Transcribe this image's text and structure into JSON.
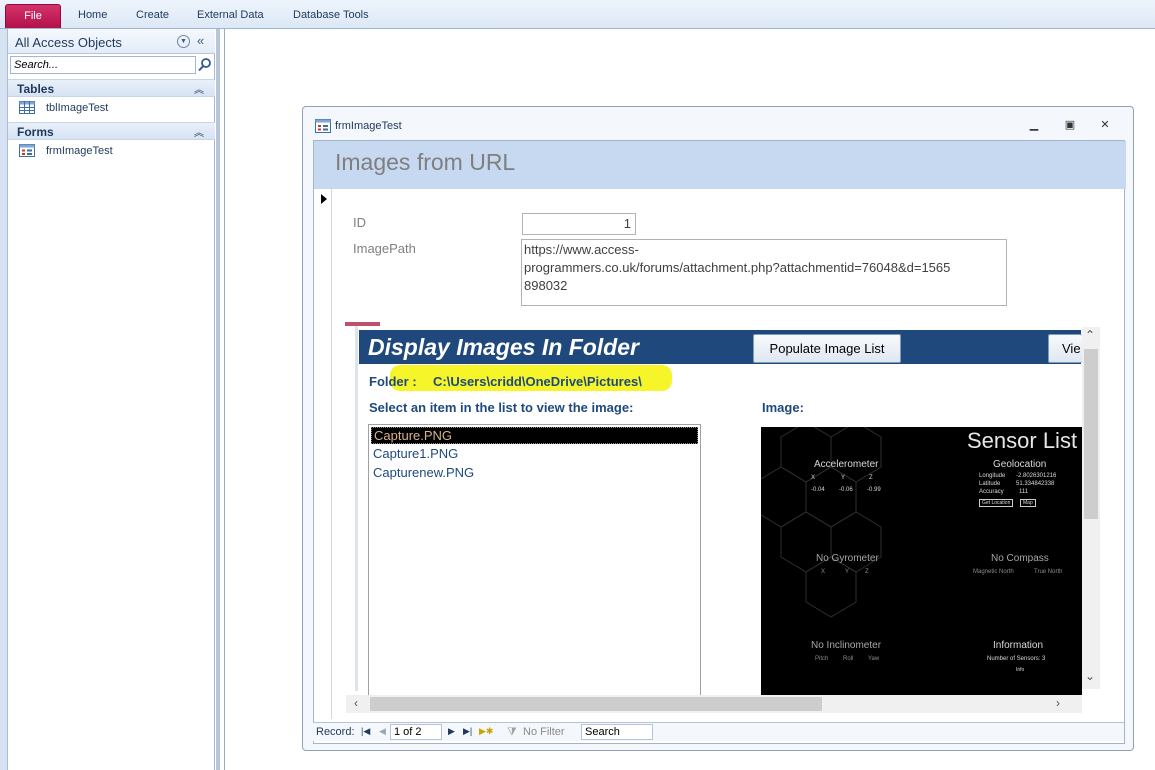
{
  "ribbon": {
    "tabs": [
      "File",
      "Home",
      "Create",
      "External Data",
      "Database Tools"
    ]
  },
  "nav": {
    "title": "All Access Objects",
    "search_placeholder": "Search...",
    "groups": [
      {
        "label": "Tables",
        "items": [
          {
            "label": "tblImageTest",
            "icon": "table-icon"
          }
        ]
      },
      {
        "label": "Forms",
        "items": [
          {
            "label": "frmImageTest",
            "icon": "form-icon"
          }
        ]
      }
    ]
  },
  "form_window": {
    "title": "frmImageTest",
    "header_title": "Images from URL",
    "fields": {
      "id_label": "ID",
      "id_value": "1",
      "path_label": "ImagePath",
      "path_value": "https://www.access-programmers.co.uk/forums/attachment.php?attachmentid=76048&d=1565898032",
      "path_lines": [
        "https://www.access-",
        "programmers.co.uk/forums/attachment.php?attachmentid=76048&d=1565",
        "898032"
      ]
    },
    "subform": {
      "title": "Display Images In Folder",
      "populate_button": "Populate Image List",
      "view_button": "Vie",
      "folder_label": "Folder :",
      "folder_path": "C:\\Users\\cridd\\OneDrive\\Pictures\\",
      "list_prompt": "Select an item in the list to view the image:",
      "image_label": "Image:",
      "files": [
        "Capture.PNG",
        "Capture1.PNG",
        "Capturenew.PNG"
      ],
      "selected_index": 0,
      "image": {
        "heading": "Sensor List",
        "accelerometer": "Accelerometer",
        "axes": [
          "X",
          "Y",
          "Z"
        ],
        "accel_values": [
          "-0.04",
          "-0.06",
          "-0.99"
        ],
        "geolocation": "Geolocation",
        "geo_rows": [
          {
            "k": "Longitude",
            "v": "-2.8026301216"
          },
          {
            "k": "Latitude",
            "v": "51.334842338"
          },
          {
            "k": "Accuracy",
            "v": "111"
          }
        ],
        "get_location": "Get Location",
        "map": "Map",
        "no_gyrometer": "No Gyrometer",
        "no_compass": "No Compass",
        "compass_sub": [
          "Magnetic North",
          "True North"
        ],
        "no_inclinometer": "No Inclinometer",
        "incl_sub": [
          "Pitch",
          "Roll",
          "Yaw"
        ],
        "information": "Information",
        "num_sensors": "Number of Sensors: 3",
        "info": "Info"
      }
    },
    "record_nav": {
      "label": "Record:",
      "position": "1 of 2",
      "filter": "No Filter",
      "search": "Search"
    }
  },
  "colors": {
    "file_tab": "#c2185b",
    "form_header": "#c6d9f1",
    "subform_header": "#1f497d",
    "highlight": "#f5f529"
  }
}
